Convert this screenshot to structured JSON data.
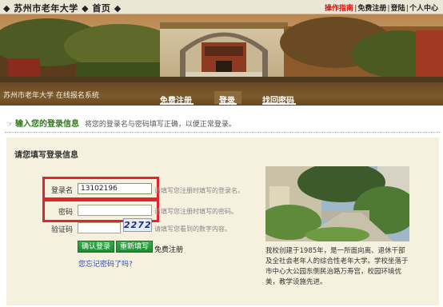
{
  "site_nav": "◆ 苏州市老年大学 ◆ 首页 ◆",
  "top_links": [
    {
      "label": "操作指南",
      "highlight": true
    },
    {
      "label": "免费注册",
      "highlight": false
    },
    {
      "label": "登陆",
      "highlight": false
    },
    {
      "label": "个人中心",
      "highlight": false
    }
  ],
  "top_link_separator": "|",
  "system_title": "苏州市老年大学  在线报名系统",
  "nav_tabs": [
    {
      "label": "免费注册",
      "active": false
    },
    {
      "label": "登录",
      "active": true
    },
    {
      "label": "找回密码",
      "active": false
    }
  ],
  "hint": {
    "title": "输入您的登录信息",
    "text": "将您的登录名与密码填写正确，以便正常登录。",
    "icon": "arrow-icon"
  },
  "form": {
    "title": "请您填写登录信息",
    "username": {
      "label": "登录名",
      "value": "13102196",
      "hint": "请填写您注册时填写的登录名。"
    },
    "password": {
      "label": "密码",
      "value": "",
      "hint": "请填写您注册时填写的密码。"
    },
    "captcha": {
      "label": "验证码",
      "value": "",
      "image_text": "2272",
      "hint": "请填写您看到的数字内容。"
    },
    "login_button": "确认登录",
    "reset_button": "重新填写",
    "register_link": "免费注册",
    "forgot_link": "您忘记密码了吗?"
  },
  "caption": "我校创建于1985年，是一所面向离、退休干部及全社会老年人的综合性老年大学。学校坐落于市中心大公园东侧民治路万寿宫，校园环境优美，教学设施先进。",
  "colors": {
    "accent_red": "#d2140f",
    "hint_green": "#2e7a18",
    "nav_brown": "#6b4a22",
    "panel_bg": "#f6f1df",
    "button_green": "#2a9a3f",
    "highlight_box": "#e2252a"
  }
}
